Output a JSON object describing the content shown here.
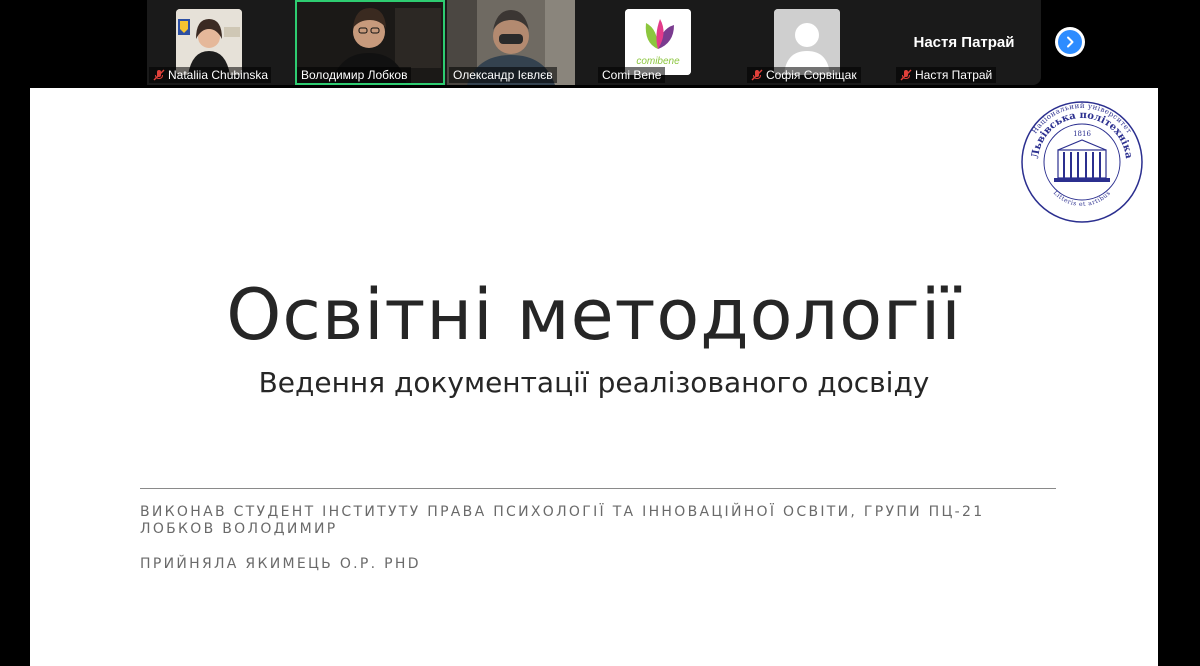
{
  "participants": [
    {
      "name": "Nataliia Chubinska",
      "muted": true
    },
    {
      "name": "Володимир Лобков",
      "muted": false,
      "active": true
    },
    {
      "name": "Олександр Ієвлєв",
      "muted": false
    },
    {
      "name": "Comi Bene",
      "muted": false,
      "logo_text": "comibene"
    },
    {
      "name": "Софія Сорвіщак",
      "muted": true
    },
    {
      "name": "Настя Патрай",
      "muted": true,
      "display_name": "Настя Патрай"
    }
  ],
  "slide": {
    "title": "Освітні методології",
    "subtitle": "Ведення документації реалізованого досвіду",
    "author_line1": "Виконав студент Інституту права психології та інноваційної освіти, групи ПЦ-21",
    "author_line2": "Лобков Володимир",
    "reviewer": "Прийняла Якимець О.Р. PhD",
    "logo": {
      "ring_top": "Національний університет",
      "ring_main": "Львівська політехніка",
      "year": "1816",
      "motto": "Litteris et artibus"
    }
  },
  "colors": {
    "accent": "#2d8cff",
    "active_border": "#2ecc71",
    "muted_icon": "#e0403a",
    "logo_blue": "#2b2f8f"
  }
}
